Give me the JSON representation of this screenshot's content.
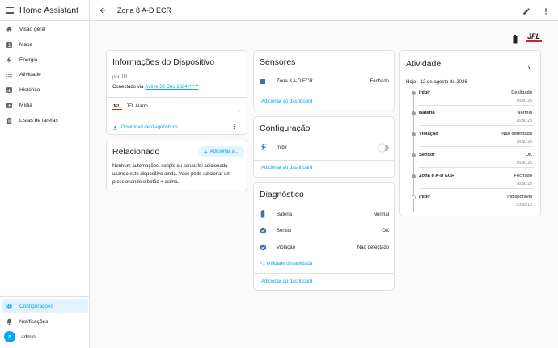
{
  "app": {
    "title": "Home Assistant"
  },
  "sidebar": {
    "items": [
      {
        "label": "Visão geral",
        "icon": "home-icon"
      },
      {
        "label": "Mapa",
        "icon": "map-icon"
      },
      {
        "label": "Energia",
        "icon": "lightning-icon"
      },
      {
        "label": "Atividade",
        "icon": "list-icon"
      },
      {
        "label": "Histórico",
        "icon": "chart-icon"
      },
      {
        "label": "Mídia",
        "icon": "media-icon"
      },
      {
        "label": "Listas de tarefas",
        "icon": "clipboard-icon"
      }
    ],
    "settings": "Configurações",
    "notifications": "Notificações",
    "user": {
      "initial": "a",
      "name": "admin"
    }
  },
  "header": {
    "title": "Zona 8 A-D ECR"
  },
  "device_info": {
    "title": "Informações do Dispositivo",
    "by": "por JFL",
    "connected_prefix": "Conectado via ",
    "connected_link": "Active 32 Duo 2684******",
    "integration": "JFL Alarm",
    "download": "Download de diagnósticos"
  },
  "related": {
    "title": "Relacionado",
    "add_button": "Adicionar a...",
    "text": "Nenhum automações, scripts ou cenas foi adicionado usando este dispositivo ainda. Você pode adicionar um pressionando o botão + acima."
  },
  "sensors": {
    "title": "Sensores",
    "entity": "Zona 8 A-D ECR",
    "state": "Fechado",
    "add_dashboard": "Adicionar ao dashboard"
  },
  "configuration": {
    "title": "Configuração",
    "entity": "Inibir",
    "add_dashboard": "Adicionar ao dashboard"
  },
  "diagnostics": {
    "title": "Diagnóstico",
    "rows": [
      {
        "label": "Bateria",
        "state": "Normal",
        "icon": "battery-icon"
      },
      {
        "label": "Sensor",
        "state": "OK",
        "icon": "check-circle-icon"
      },
      {
        "label": "Violação",
        "state": "Não detectado",
        "icon": "check-circle-icon"
      }
    ],
    "disabled": "+1 entidade desabilitada",
    "add_dashboard": "Adicionar ao dashboard"
  },
  "activity": {
    "title": "Atividade",
    "date": "Hoje - 12 de agosto de 2026",
    "events": [
      {
        "label": "Inibir",
        "state": "Desligado",
        "time": "16:50:25"
      },
      {
        "label": "Bateria",
        "state": "Normal",
        "time": "16:50:25"
      },
      {
        "label": "Violação",
        "state": "Não detectado",
        "time": "16:50:25"
      },
      {
        "label": "Sensor",
        "state": "OK",
        "time": "16:50:25"
      },
      {
        "label": "Zona 8 A-D ECR",
        "state": "Fechado",
        "time": "16:50:25"
      },
      {
        "label": "Inibir",
        "state": "Indisponível",
        "time": "03:55:12"
      }
    ]
  },
  "brand_logo": "JFL",
  "colors": {
    "accent": "#03a9f4",
    "active_bg": "#e3f2fd",
    "brand_red": "#c62828"
  }
}
